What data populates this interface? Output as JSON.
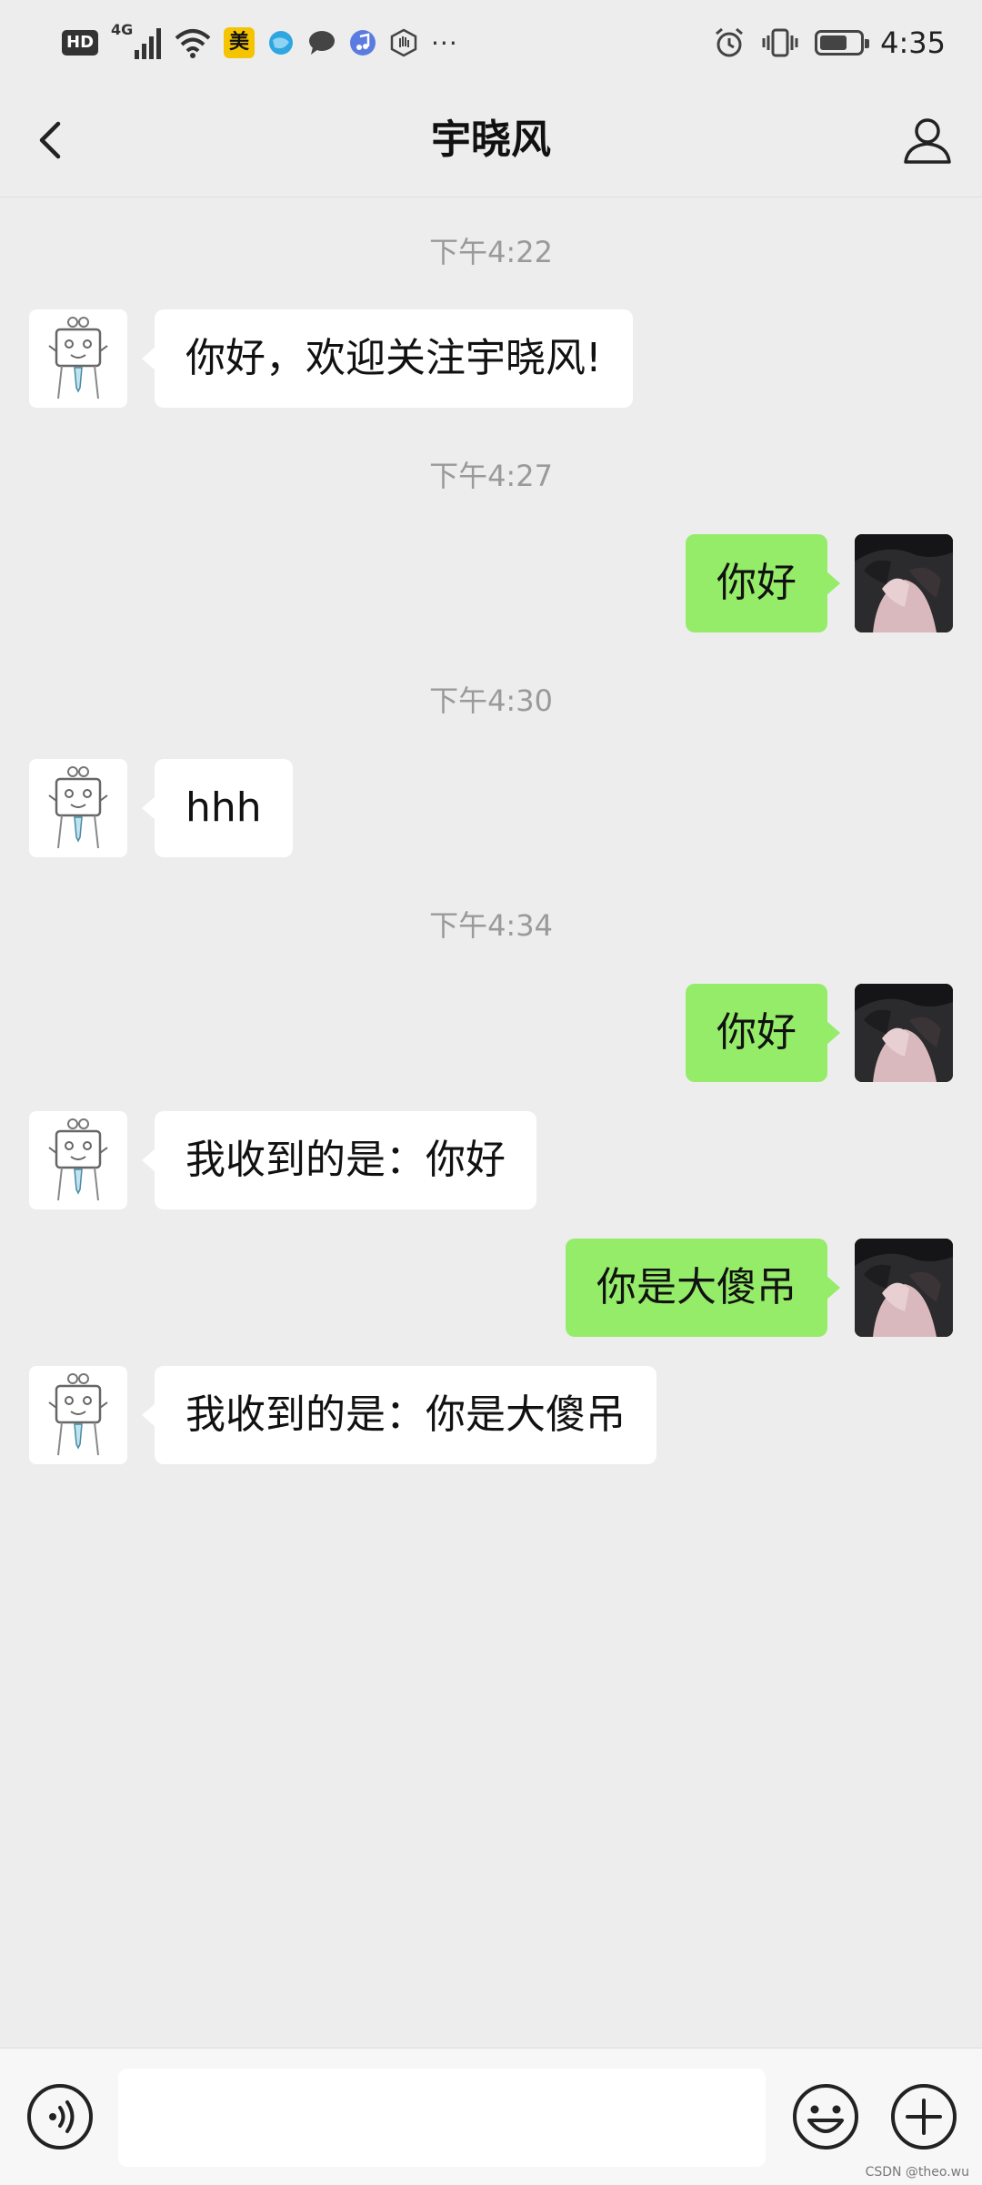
{
  "status_bar": {
    "hd": "HD",
    "network": "4G",
    "app_badge": "美",
    "more": "···",
    "battery_level": 0.7,
    "time": "4:35"
  },
  "header": {
    "title": "宇晓风",
    "back_icon": "chevron-left-icon",
    "profile_icon": "person-icon"
  },
  "messages": [
    {
      "time": "下午4:22"
    },
    {
      "from": "bot",
      "text": "你好，欢迎关注宇晓风!"
    },
    {
      "time": "下午4:27"
    },
    {
      "from": "user",
      "text": "你好"
    },
    {
      "time": "下午4:30"
    },
    {
      "from": "bot",
      "text": "hhh"
    },
    {
      "time": "下午4:34"
    },
    {
      "from": "user",
      "text": "你好"
    },
    {
      "from": "bot",
      "text": "我收到的是：你好"
    },
    {
      "from": "user",
      "text": "你是大傻吊"
    },
    {
      "from": "bot",
      "text": "我收到的是：你是大傻吊"
    }
  ],
  "input_bar": {
    "voice_icon": "voice-icon",
    "text_value": "",
    "emoji_icon": "emoji-icon",
    "add_icon": "plus-icon"
  },
  "colors": {
    "background": "#ededed",
    "outgoing_bubble": "#95ec69",
    "incoming_bubble": "#ffffff"
  },
  "watermark": "CSDN @theo.wu"
}
